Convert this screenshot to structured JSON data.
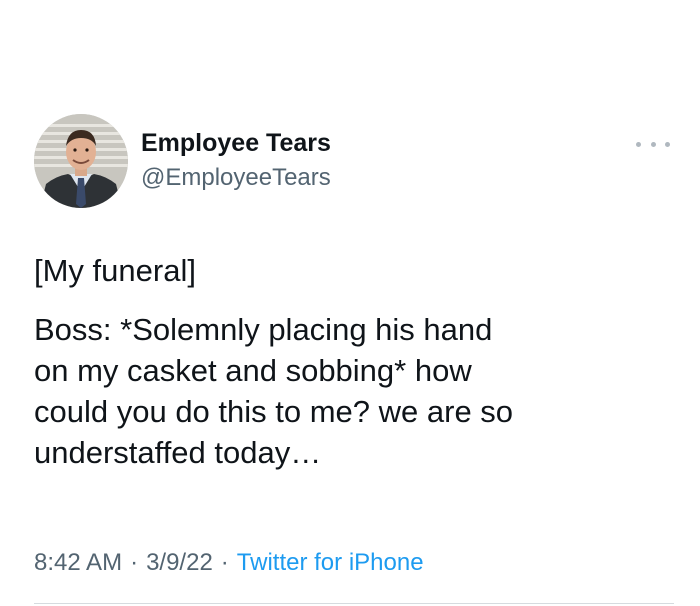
{
  "author": {
    "display_name": "Employee Tears",
    "handle": "@EmployeeTears",
    "avatar_icon": "profile-photo-man-in-suit"
  },
  "more_icon": "more-horizontal-icon",
  "tweet": {
    "paragraphs": [
      "[My funeral]",
      "Boss: *Solemnly placing his hand\non my casket and sobbing* how\ncould you do this to me? we are so\nunderstaffed today…"
    ]
  },
  "meta": {
    "time": "8:42 AM",
    "separator": "·",
    "date": "3/9/22",
    "source": "Twitter for iPhone"
  },
  "colors": {
    "text": "#0f1419",
    "secondary": "#536471",
    "link": "#1d9bf0"
  }
}
